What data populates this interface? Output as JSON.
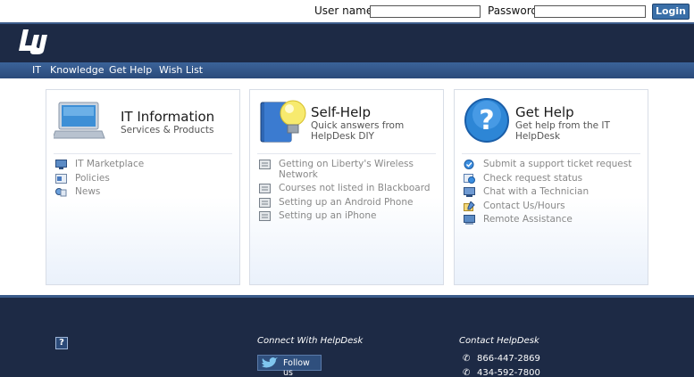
{
  "login": {
    "username_label": "User name:",
    "username_value": "",
    "password_label": "Password:",
    "password_value": "",
    "login_button": "Login"
  },
  "header": {
    "logo_text": "LU"
  },
  "nav": {
    "items": [
      "IT",
      "Knowledge",
      "Get Help",
      "Wish List"
    ]
  },
  "panels": [
    {
      "title": "IT Information",
      "subtitle": "Services & Products",
      "icon": "laptop-icon",
      "items": [
        {
          "label": "IT Marketplace",
          "icon": "monitor-icon"
        },
        {
          "label": "Policies",
          "icon": "policy-icon"
        },
        {
          "label": "News",
          "icon": "news-icon"
        }
      ]
    },
    {
      "title": "Self-Help",
      "subtitle_line1": "Quick answers from",
      "subtitle_line2": "HelpDesk DIY",
      "icon": "lightbulb-book-icon",
      "items": [
        {
          "label_line1": "Getting on Liberty's Wireless",
          "label_line2": "Network",
          "icon": "document-icon"
        },
        {
          "label": "Courses not listed in Blackboard",
          "icon": "document-icon"
        },
        {
          "label": "Setting up an Android Phone",
          "icon": "document-icon"
        },
        {
          "label": "Setting up an iPhone",
          "icon": "document-icon"
        }
      ]
    },
    {
      "title": "Get Help",
      "subtitle_line1": "Get help from the IT",
      "subtitle_line2": "HelpDesk",
      "icon": "question-mark-icon",
      "items": [
        {
          "label": "Submit a support ticket request",
          "icon": "ticket-icon"
        },
        {
          "label": "Check request status",
          "icon": "status-icon"
        },
        {
          "label": "Chat with a Technician",
          "icon": "chat-icon"
        },
        {
          "label": "Contact Us/Hours",
          "icon": "contact-icon"
        },
        {
          "label": "Remote Assistance",
          "icon": "remote-icon"
        }
      ]
    }
  ],
  "footer": {
    "help_icon": "?",
    "connect_title": "Connect With HelpDesk",
    "follow_label": "Follow us",
    "contact_title": "Contact HelpDesk",
    "phones": [
      "866-447-2869",
      "434-592-7800"
    ]
  },
  "colors": {
    "header_bg": "#1d2a45",
    "nav_bg": "#2f5286",
    "login_button": "#3a6fa8"
  }
}
